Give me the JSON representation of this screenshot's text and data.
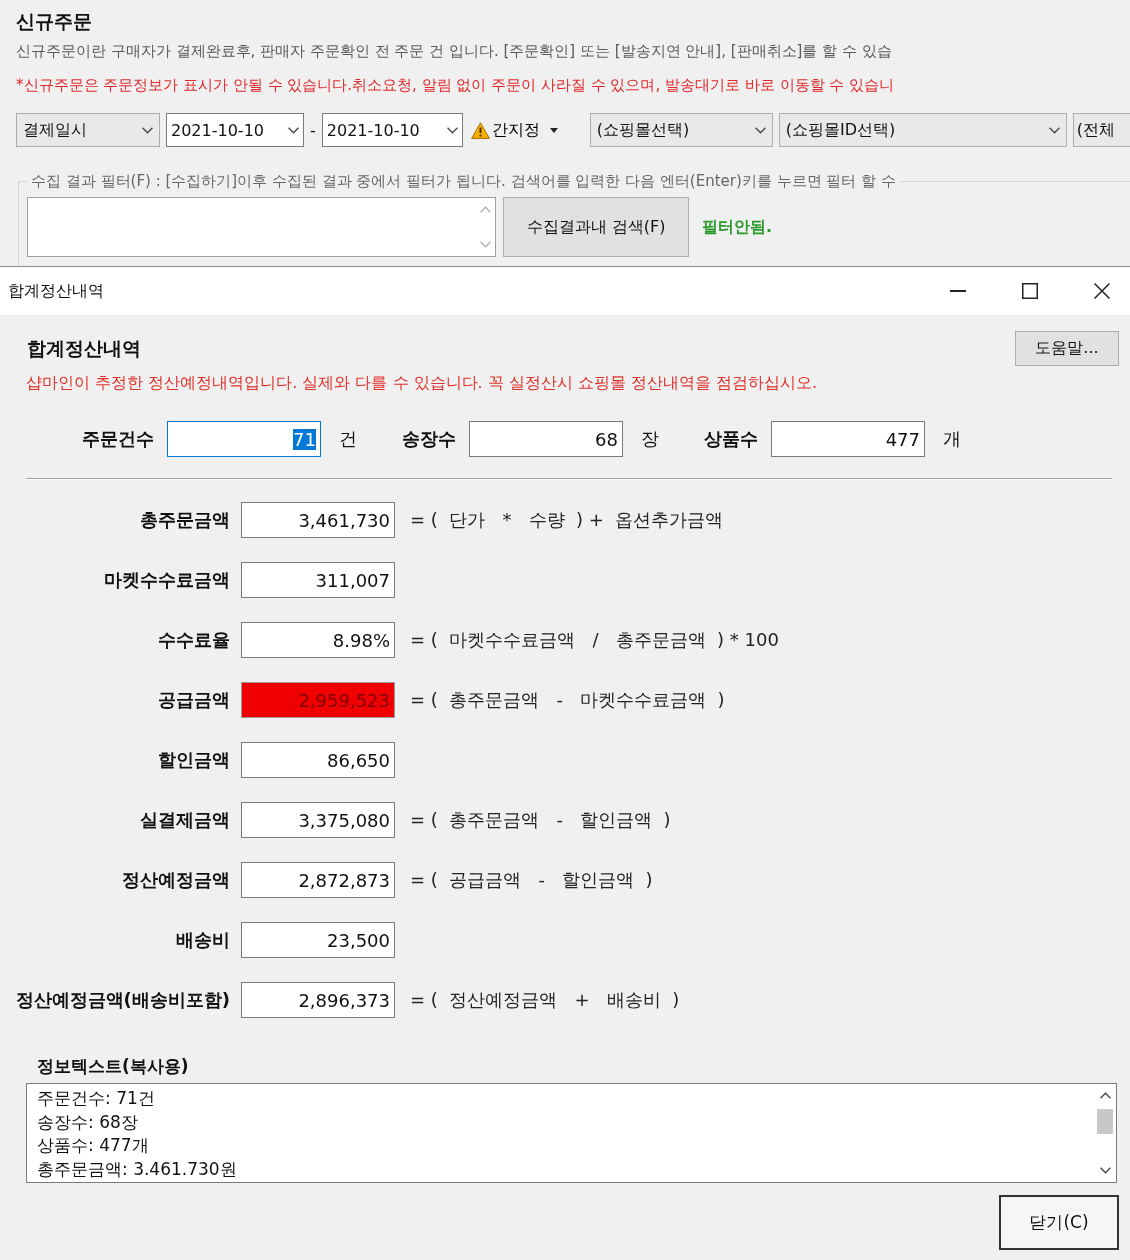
{
  "main_window": {
    "title": "신규주문",
    "description": "신규주문이란 구매자가 결제완료후, 판매자 주문확인 전 주문 건 입니다. [주문확인] 또는 [발송지연 안내], [판매취소]를 할 수 있습",
    "warning": "*신규주문은 주문정보가 표시가 안될 수 있습니다.취소요청, 알림 없이 주문이 사라질 수 있으며, 발송대기로 바로 이동할 수 있습니",
    "toolbar": [
      {
        "kind": "dropdown",
        "value": "결제일시"
      },
      {
        "kind": "date",
        "value": "2021-10-10"
      },
      {
        "kind": "separator",
        "text": "-"
      },
      {
        "kind": "date",
        "value": "2021-10-10"
      },
      {
        "kind": "period_button",
        "label": "간지정"
      },
      {
        "kind": "dropdown",
        "value": "(쇼핑몰선택)"
      },
      {
        "kind": "dropdown",
        "value": "(쇼핑몰ID선택)"
      },
      {
        "kind": "dropdown",
        "value": "(전체"
      }
    ],
    "filter": {
      "legend": "수집 결과 필터(F) : [수집하기]이후 수집된 결과 중에서 필터가 됩니다. 검색어를 입력한 다음 엔터(Enter)키를 누르면 필터 할 수",
      "button": "수집결과내 검색(F)",
      "status": "필터안됨."
    }
  },
  "dialog": {
    "title": "합계정산내역",
    "heading": "합계정산내역",
    "help_button": "도움말...",
    "notice": "샵마인이 추정한 정산예정내역입니다. 실제와 다를 수 있습니다. 꼭 실정산시 쇼핑몰 정산내역을 점검하십시오.",
    "counts": [
      {
        "label": "주문건수",
        "value": "71",
        "unit": "건",
        "focused": true
      },
      {
        "label": "송장수",
        "value": "68",
        "unit": "장",
        "focused": false
      },
      {
        "label": "상품수",
        "value": "477",
        "unit": "개",
        "focused": false
      }
    ],
    "amounts": [
      {
        "label": "총주문금액",
        "value": "3,461,730",
        "alert": false,
        "formula": "= (  단가   *   수량  ) +  옵션추가금액"
      },
      {
        "label": "마켓수수료금액",
        "value": "311,007",
        "alert": false
      },
      {
        "label": "수수료율",
        "value": "8.98%",
        "alert": false,
        "formula": "= (  마켓수수료금액   /   총주문금액  ) * 100"
      },
      {
        "label": "공급금액",
        "value": "2,959,523",
        "alert": true,
        "formula": "= (  총주문금액   -   마켓수수료금액  )"
      },
      {
        "label": "할인금액",
        "value": "86,650",
        "alert": false
      },
      {
        "label": "실결제금액",
        "value": "3,375,080",
        "alert": false,
        "formula": "= (  총주문금액   -   할인금액  )"
      },
      {
        "label": "정산예정금액",
        "value": "2,872,873",
        "alert": false,
        "formula": "= (  공급금액   -   할인금액  )"
      },
      {
        "label": "배송비",
        "value": "23,500",
        "alert": false
      },
      {
        "label": "정산예정금액(배송비포함)",
        "value": "2,896,373",
        "alert": false,
        "formula": "= (  정산예정금액   +   배송비  )"
      }
    ],
    "info_label": "정보텍스트(복사용)",
    "info_lines": [
      "주문건수: 71건",
      "송장수: 68장",
      "상품수: 477개",
      "총주문금액: 3.461.730원"
    ],
    "close_button": "닫기(C)"
  }
}
